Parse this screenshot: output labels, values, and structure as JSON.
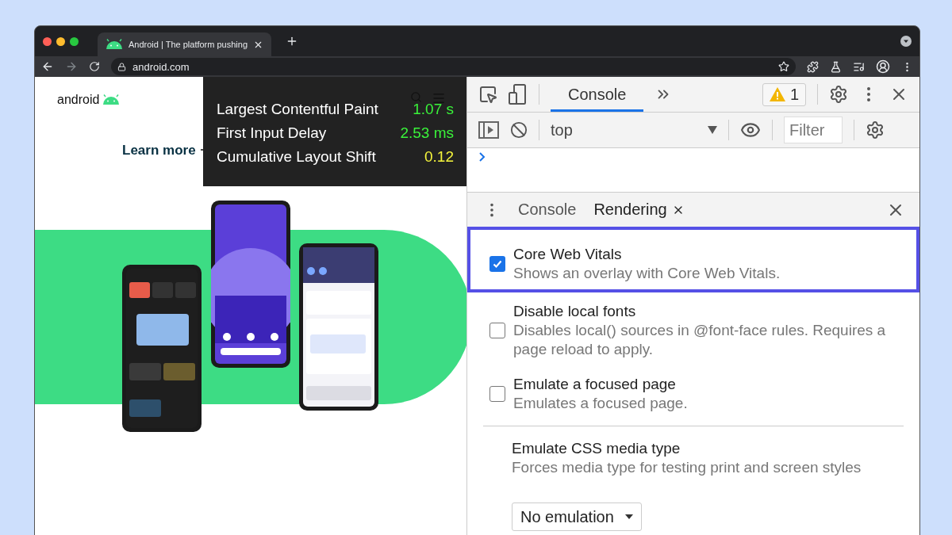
{
  "browser": {
    "tabs": [
      {
        "title": "Android | The platform pushing",
        "selected": true
      }
    ],
    "address": "android.com"
  },
  "page": {
    "logo": "android",
    "link": "Learn more",
    "vitals": [
      {
        "label": "Largest Contentful Paint",
        "value": "1.07 s",
        "color": "#3af23a"
      },
      {
        "label": "First Input Delay",
        "value": "2.53 ms",
        "color": "#3af23a"
      },
      {
        "label": "Cumulative Layout Shift",
        "value": "0.12",
        "color": "#f5f53c"
      }
    ]
  },
  "devtools": {
    "main_tabs": [
      {
        "label": "Console",
        "selected": true
      }
    ],
    "warning_count": "1",
    "context": "top",
    "filter": {
      "placeholder": "Filter"
    },
    "drawer_tabs": [
      {
        "label": "Console",
        "selected": false,
        "closable": false
      },
      {
        "label": "Rendering",
        "selected": true,
        "closable": true
      }
    ],
    "rendering_options": [
      {
        "kind": "checkbox",
        "title": "Core Web Vitals",
        "description": "Shows an overlay with Core Web Vitals.",
        "checked": true,
        "highlighted": true
      },
      {
        "kind": "checkbox",
        "title": "Disable local fonts",
        "description": "Disables local() sources in @font-face rules. Requires a page reload to apply.",
        "checked": false,
        "highlighted": false
      },
      {
        "kind": "checkbox",
        "title": "Emulate a focused page",
        "description": "Emulates a focused page.",
        "checked": false,
        "highlighted": false
      },
      {
        "kind": "divider"
      },
      {
        "kind": "select",
        "title": "Emulate CSS media type",
        "description": "Forces media type for testing print and screen styles",
        "value": "No emulation",
        "highlighted": false
      }
    ]
  }
}
